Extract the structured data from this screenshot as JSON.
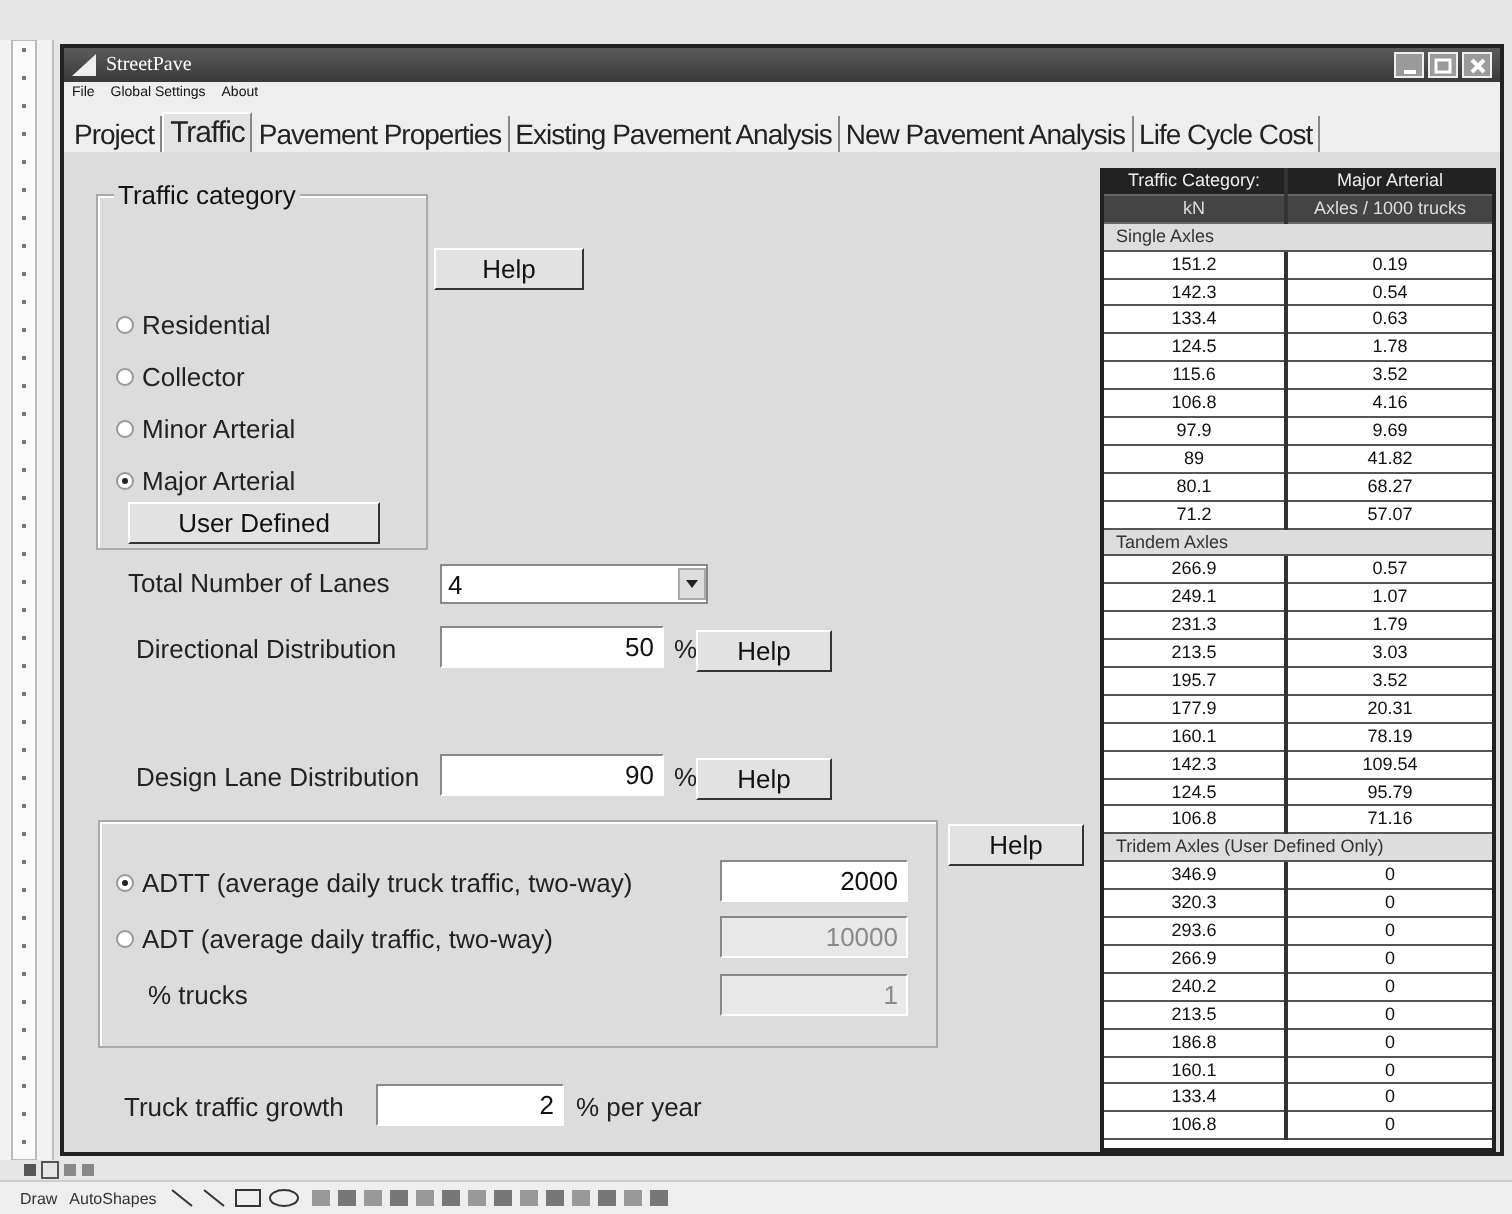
{
  "window": {
    "title": "StreetPave"
  },
  "menu": [
    "File",
    "Global Settings",
    "About"
  ],
  "tabs": [
    {
      "label": "Project",
      "selected": false
    },
    {
      "label": "Traffic",
      "selected": true
    },
    {
      "label": "Pavement Properties",
      "selected": false
    },
    {
      "label": "Existing Pavement Analysis",
      "selected": false
    },
    {
      "label": "New Pavement Analysis",
      "selected": false
    },
    {
      "label": "Life Cycle Cost",
      "selected": false
    }
  ],
  "traffic_category": {
    "legend": "Traffic category",
    "options": [
      {
        "label": "Residential",
        "selected": false
      },
      {
        "label": "Collector",
        "selected": false
      },
      {
        "label": "Minor Arterial",
        "selected": false
      },
      {
        "label": "Major Arterial",
        "selected": true
      }
    ],
    "user_defined_button": "User Defined",
    "help_button": "Help"
  },
  "total_lanes": {
    "label": "Total Number of Lanes",
    "value": "4"
  },
  "directional_distribution": {
    "label": "Directional Distribution",
    "value": "50",
    "unit": "%",
    "help_button": "Help"
  },
  "design_lane_distribution": {
    "label": "Design Lane Distribution",
    "value": "90",
    "unit": "%",
    "help_button": "Help"
  },
  "volume": {
    "help_button": "Help",
    "options": [
      {
        "label": "ADTT (average daily truck traffic, two-way)",
        "selected": true,
        "value": "2000",
        "disabled": false
      },
      {
        "label": "ADT (average daily traffic, two-way)",
        "selected": false,
        "value": "10000",
        "disabled": true
      }
    ],
    "trucks": {
      "label": "% trucks",
      "value": "1",
      "disabled": true
    }
  },
  "growth": {
    "label": "Truck traffic growth",
    "value": "2",
    "unit": "% per year"
  },
  "load_table": {
    "header": [
      "Traffic Category:",
      "Major Arterial"
    ],
    "columns": [
      "kN",
      "Axles / 1000 trucks"
    ],
    "sections": [
      {
        "title": "Single Axles",
        "rows": [
          [
            "151.2",
            "0.19"
          ],
          [
            "142.3",
            "0.54"
          ],
          [
            "133.4",
            "0.63"
          ],
          [
            "124.5",
            "1.78"
          ],
          [
            "115.6",
            "3.52"
          ],
          [
            "106.8",
            "4.16"
          ],
          [
            "97.9",
            "9.69"
          ],
          [
            "89",
            "41.82"
          ],
          [
            "80.1",
            "68.27"
          ],
          [
            "71.2",
            "57.07"
          ]
        ]
      },
      {
        "title": "Tandem Axles",
        "rows": [
          [
            "266.9",
            "0.57"
          ],
          [
            "249.1",
            "1.07"
          ],
          [
            "231.3",
            "1.79"
          ],
          [
            "213.5",
            "3.03"
          ],
          [
            "195.7",
            "3.52"
          ],
          [
            "177.9",
            "20.31"
          ],
          [
            "160.1",
            "78.19"
          ],
          [
            "142.3",
            "109.54"
          ],
          [
            "124.5",
            "95.79"
          ],
          [
            "106.8",
            "71.16"
          ]
        ]
      },
      {
        "title": "Tridem Axles (User Defined Only)",
        "rows": [
          [
            "346.9",
            "0"
          ],
          [
            "320.3",
            "0"
          ],
          [
            "293.6",
            "0"
          ],
          [
            "266.9",
            "0"
          ],
          [
            "240.2",
            "0"
          ],
          [
            "213.5",
            "0"
          ],
          [
            "186.8",
            "0"
          ],
          [
            "160.1",
            "0"
          ],
          [
            "133.4",
            "0"
          ],
          [
            "106.8",
            "0"
          ]
        ]
      }
    ]
  },
  "drawing_toolbar": [
    "Draw",
    "AutoShapes"
  ]
}
